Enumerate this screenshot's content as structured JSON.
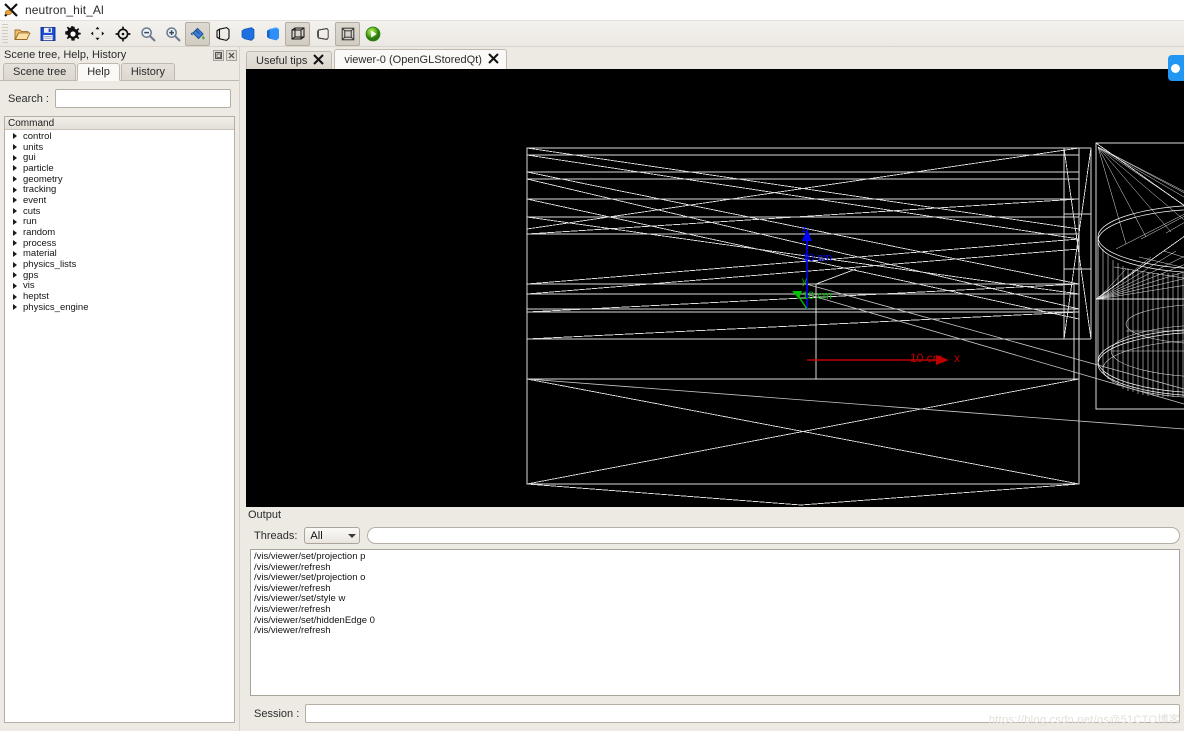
{
  "window": {
    "title": "neutron_hit_Al",
    "app_icon": "geant4-x-icon"
  },
  "toolbar": {
    "buttons": [
      {
        "name": "open-file-button",
        "icon": "folder-open-icon",
        "pressed": false
      },
      {
        "name": "save-file-button",
        "icon": "floppy-save-icon",
        "pressed": false
      },
      {
        "name": "settings-button",
        "icon": "gear-icon",
        "pressed": false
      },
      {
        "name": "move-button",
        "icon": "move-arrows-icon",
        "pressed": false
      },
      {
        "name": "rotate-button",
        "icon": "crosshair-rotate-icon",
        "pressed": false
      },
      {
        "name": "zoom-out-button",
        "icon": "magnifier-minus-icon",
        "pressed": false
      },
      {
        "name": "zoom-in-button",
        "icon": "magnifier-plus-icon",
        "pressed": false
      },
      {
        "name": "pick-button",
        "icon": "paint-pick-icon",
        "pressed": true
      },
      {
        "name": "wireframe-style-button",
        "icon": "cube-wireframe-icon",
        "pressed": false
      },
      {
        "name": "hidden-line-button",
        "icon": "cube-half-solid-icon",
        "pressed": false
      },
      {
        "name": "surface-style-button",
        "icon": "cube-solid-blue-icon",
        "pressed": false
      },
      {
        "name": "perspective-button",
        "icon": "cube-perspective-icon",
        "pressed": true
      },
      {
        "name": "ortho-button",
        "icon": "cube-ortho-icon",
        "pressed": false
      },
      {
        "name": "projection-button",
        "icon": "cube-projection-icon",
        "pressed": true
      },
      {
        "name": "run-beam-on-button",
        "icon": "green-play-icon",
        "pressed": false
      }
    ]
  },
  "left_dock": {
    "title": "Scene tree, Help, History",
    "float_button": "float-icon",
    "close_button": "close-icon",
    "tabs": [
      {
        "label": "Scene tree",
        "active": false
      },
      {
        "label": "Help",
        "active": true
      },
      {
        "label": "History",
        "active": false
      }
    ],
    "search": {
      "label": "Search :",
      "value": "",
      "placeholder": ""
    },
    "command_tree": {
      "header": "Command",
      "items": [
        "control",
        "units",
        "gui",
        "particle",
        "geometry",
        "tracking",
        "event",
        "cuts",
        "run",
        "random",
        "process",
        "material",
        "physics_lists",
        "gps",
        "vis",
        "heptst",
        "physics_engine"
      ]
    }
  },
  "viewer": {
    "tabs": [
      {
        "label": "Useful tips",
        "active": false,
        "close_icon": "close-x-icon"
      },
      {
        "label": "viewer-0 (OpenGLStoredQt)",
        "active": true,
        "close_icon": "close-x-icon"
      }
    ],
    "background": "#000000",
    "axes": [
      {
        "name": "z-axis",
        "label": "10 cm",
        "color": "#0000ff"
      },
      {
        "name": "y-axis",
        "label": "10 cm",
        "color": "#00c000"
      },
      {
        "name": "x-axis",
        "label": "10 cm x",
        "color": "#c00000"
      }
    ],
    "axis_letters": [
      {
        "name": "z-axis-letter",
        "text": "z",
        "color": "#0000ff"
      },
      {
        "name": "y-axis-letter",
        "text": "y",
        "color": "#00c000"
      }
    ],
    "geometry_color": "#ffffff"
  },
  "output_dock": {
    "title": "Output",
    "threads": {
      "label": "Threads:",
      "selected": "All",
      "options": [
        "All"
      ]
    },
    "filter": {
      "value": "",
      "placeholder": ""
    },
    "lines": [
      "/vis/viewer/set/projection p",
      "/vis/viewer/refresh",
      "/vis/viewer/set/projection o",
      "/vis/viewer/refresh",
      "/vis/viewer/set/style w",
      "/vis/viewer/refresh",
      "/vis/viewer/set/hiddenEdge 0",
      "/vis/viewer/refresh"
    ]
  },
  "session": {
    "label": "Session :",
    "value": "",
    "placeholder": ""
  },
  "edge_button": {
    "name": "edge-floating-button",
    "color": "#2196f3"
  },
  "watermark": {
    "text": "https://blog.csdn.net/qs@51CTO博客"
  }
}
